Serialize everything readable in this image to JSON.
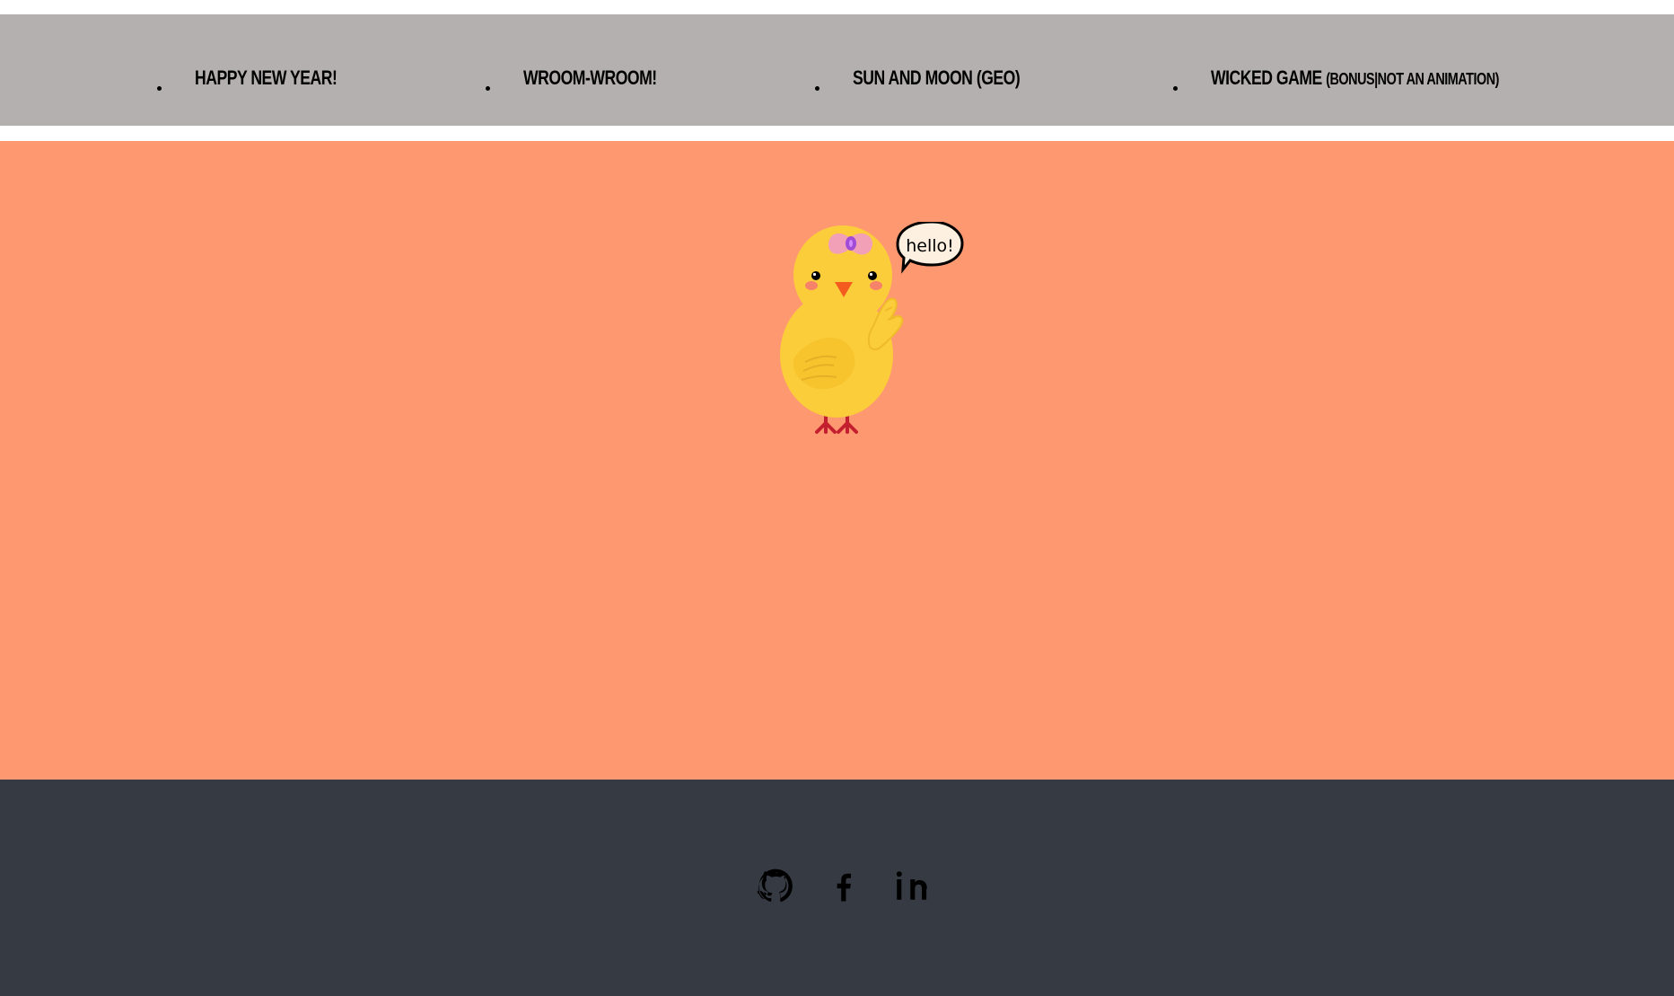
{
  "nav": {
    "items": [
      {
        "label": "HAPPY NEW YEAR!"
      },
      {
        "label": "WROOM-WROOM!"
      },
      {
        "label": "SUN AND MOON (GEO)"
      },
      {
        "label": "WICKED GAME",
        "sub_label": "(BONUS|NOT AN ANIMATION)"
      }
    ]
  },
  "stage": {
    "speech_bubble_text": "hello!"
  },
  "footer": {
    "social": [
      {
        "icon": "github-icon"
      },
      {
        "icon": "facebook-icon"
      },
      {
        "icon": "linkedin-icon"
      }
    ]
  },
  "colors": {
    "nav_bg": "#b5b0b0",
    "stage_bg": "#fe9870",
    "footer_bg": "#363a42",
    "chick_body": "#fbcd3a",
    "chick_belly": "#f7c42e",
    "bow": "#f2a0b8",
    "bow_center": "#a14bd7",
    "beak": "#f45b1f",
    "legs": "#c41f2f",
    "cheeks": "#f47a6f"
  }
}
